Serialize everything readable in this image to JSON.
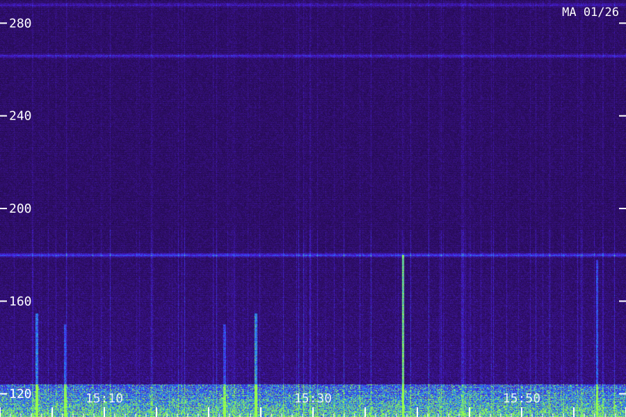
{
  "station_label": "MA 01/26",
  "colors": {
    "background": "#2a1055",
    "low": "#1a0840",
    "mid": "#4a20c8",
    "high": "#2080ff",
    "peak": "#80ff40",
    "text": "#ffffff"
  },
  "chart_data": {
    "type": "heatmap",
    "title": "",
    "xlabel": "",
    "ylabel": "",
    "y_ticks": [
      280,
      240,
      200,
      160,
      120
    ],
    "ylim": [
      110,
      290
    ],
    "x_tick_labels": [
      "15:10",
      "15:30",
      "15:50"
    ],
    "xlim_minutes": [
      0,
      60
    ],
    "x_label_minutes": [
      10,
      30,
      50
    ],
    "grid": false,
    "legend": "none",
    "horizontal_bands": [
      {
        "y": 288,
        "intensity": 0.35
      },
      {
        "y": 266,
        "intensity": 0.45
      },
      {
        "y": 180,
        "intensity": 0.6
      }
    ],
    "vertical_bursts": [
      {
        "x": 3.5,
        "y_top": 155,
        "intensity": 0.7
      },
      {
        "x": 6.2,
        "y_top": 150,
        "intensity": 0.6
      },
      {
        "x": 21.5,
        "y_top": 150,
        "intensity": 0.55
      },
      {
        "x": 24.5,
        "y_top": 155,
        "intensity": 0.75
      },
      {
        "x": 38.6,
        "y_top": 180,
        "intensity": 0.9
      },
      {
        "x": 57.2,
        "y_top": 178,
        "intensity": 0.6
      }
    ]
  }
}
